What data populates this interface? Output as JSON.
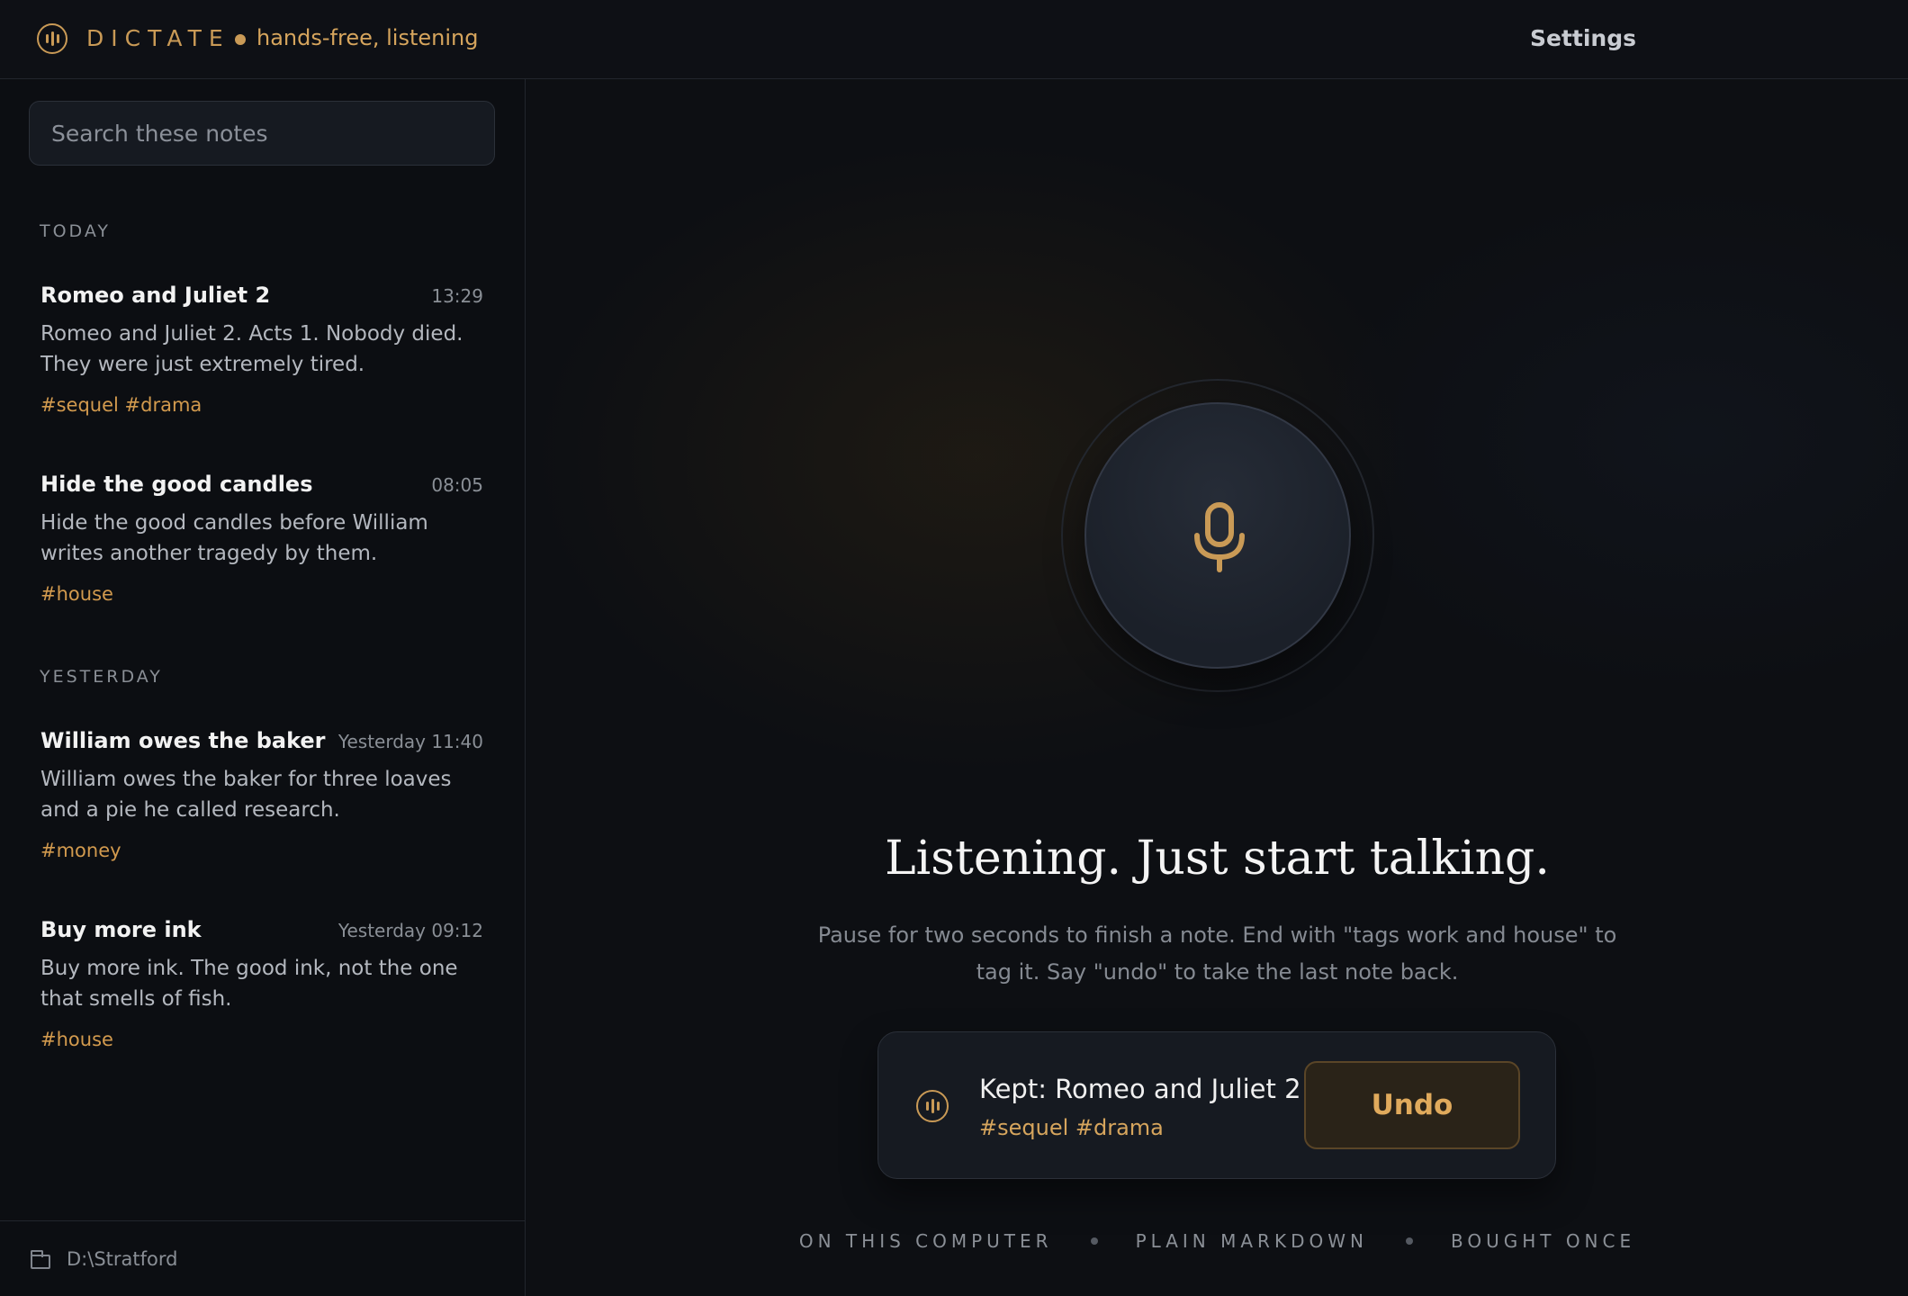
{
  "app": {
    "brand": "DICTATE",
    "status": "hands-free, listening",
    "settings_label": "Settings",
    "accent_color": "#c99a56"
  },
  "sidebar": {
    "search_placeholder": "Search these notes",
    "sections": [
      {
        "label": "TODAY",
        "notes": [
          {
            "title": "Romeo and Juliet 2",
            "time": "13:29",
            "body": "Romeo and Juliet 2. Acts 1. Nobody died. They were just extremely tired.",
            "tags": "#sequel #drama"
          },
          {
            "title": "Hide the good candles",
            "time": "08:05",
            "body": "Hide the good candles before William writes another tragedy by them.",
            "tags": "#house"
          }
        ]
      },
      {
        "label": "YESTERDAY",
        "notes": [
          {
            "title": "William owes the baker",
            "time": "Yesterday 11:40",
            "body": "William owes the baker for three loaves and a pie he called research.",
            "tags": "#money"
          },
          {
            "title": "Buy more ink",
            "time": "Yesterday 09:12",
            "body": "Buy more ink. The good ink, not the one that smells of fish.",
            "tags": "#house"
          }
        ]
      }
    ],
    "folder_path": "D:\\Stratford"
  },
  "main": {
    "headline": "Listening. Just start talking.",
    "subline": "Pause for two seconds to finish a note. End with \"tags work and house\" to tag it. Say \"undo\" to take the last note back.",
    "toast": {
      "title": "Kept: Romeo and Juliet 2",
      "tags": "#sequel #drama",
      "undo_label": "Undo"
    },
    "footer": [
      "ON THIS COMPUTER",
      "PLAIN MARKDOWN",
      "BOUGHT ONCE"
    ]
  }
}
